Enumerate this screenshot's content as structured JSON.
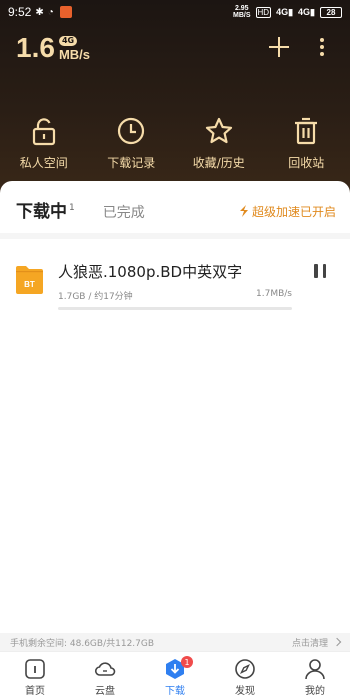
{
  "status_bar": {
    "time": "9:52",
    "speed_value": "2.95",
    "speed_unit": "MB/S",
    "hd": "HD",
    "signal1": "4G",
    "signal2": "4G",
    "battery": "28"
  },
  "header": {
    "speed_value": "1.6",
    "network_badge": "4G",
    "speed_unit": "MB/s"
  },
  "quick_actions": [
    {
      "label": "私人空间",
      "icon": "lock-open-icon"
    },
    {
      "label": "下载记录",
      "icon": "clock-icon"
    },
    {
      "label": "收藏/历史",
      "icon": "star-icon"
    },
    {
      "label": "回收站",
      "icon": "trash-icon"
    }
  ],
  "tabs": {
    "active_label": "下载中",
    "active_count": "1",
    "done_label": "已完成",
    "boost_label": "超级加速已开启"
  },
  "task": {
    "title": "人狼恶.1080p.BD中英双字",
    "size_eta": "1.7GB / 约17分钟",
    "rate": "1.7MB/s",
    "icon_label": "BT",
    "progress": 0
  },
  "storage": {
    "text": "手机剩余空间: 48.6GB/共112.7GB",
    "clean_label": "点击清理"
  },
  "bottom_nav": [
    {
      "label": "首页",
      "icon": "home-icon"
    },
    {
      "label": "云盘",
      "icon": "cloud-icon"
    },
    {
      "label": "下载",
      "icon": "download-icon",
      "badge": "1",
      "active": true
    },
    {
      "label": "发现",
      "icon": "compass-icon"
    },
    {
      "label": "我的",
      "icon": "person-icon"
    }
  ],
  "colors": {
    "accent_gold": "#f6dcaa",
    "active_blue": "#2f7ff0",
    "boost_orange": "#e08a1e",
    "folder_orange": "#f5a623"
  }
}
